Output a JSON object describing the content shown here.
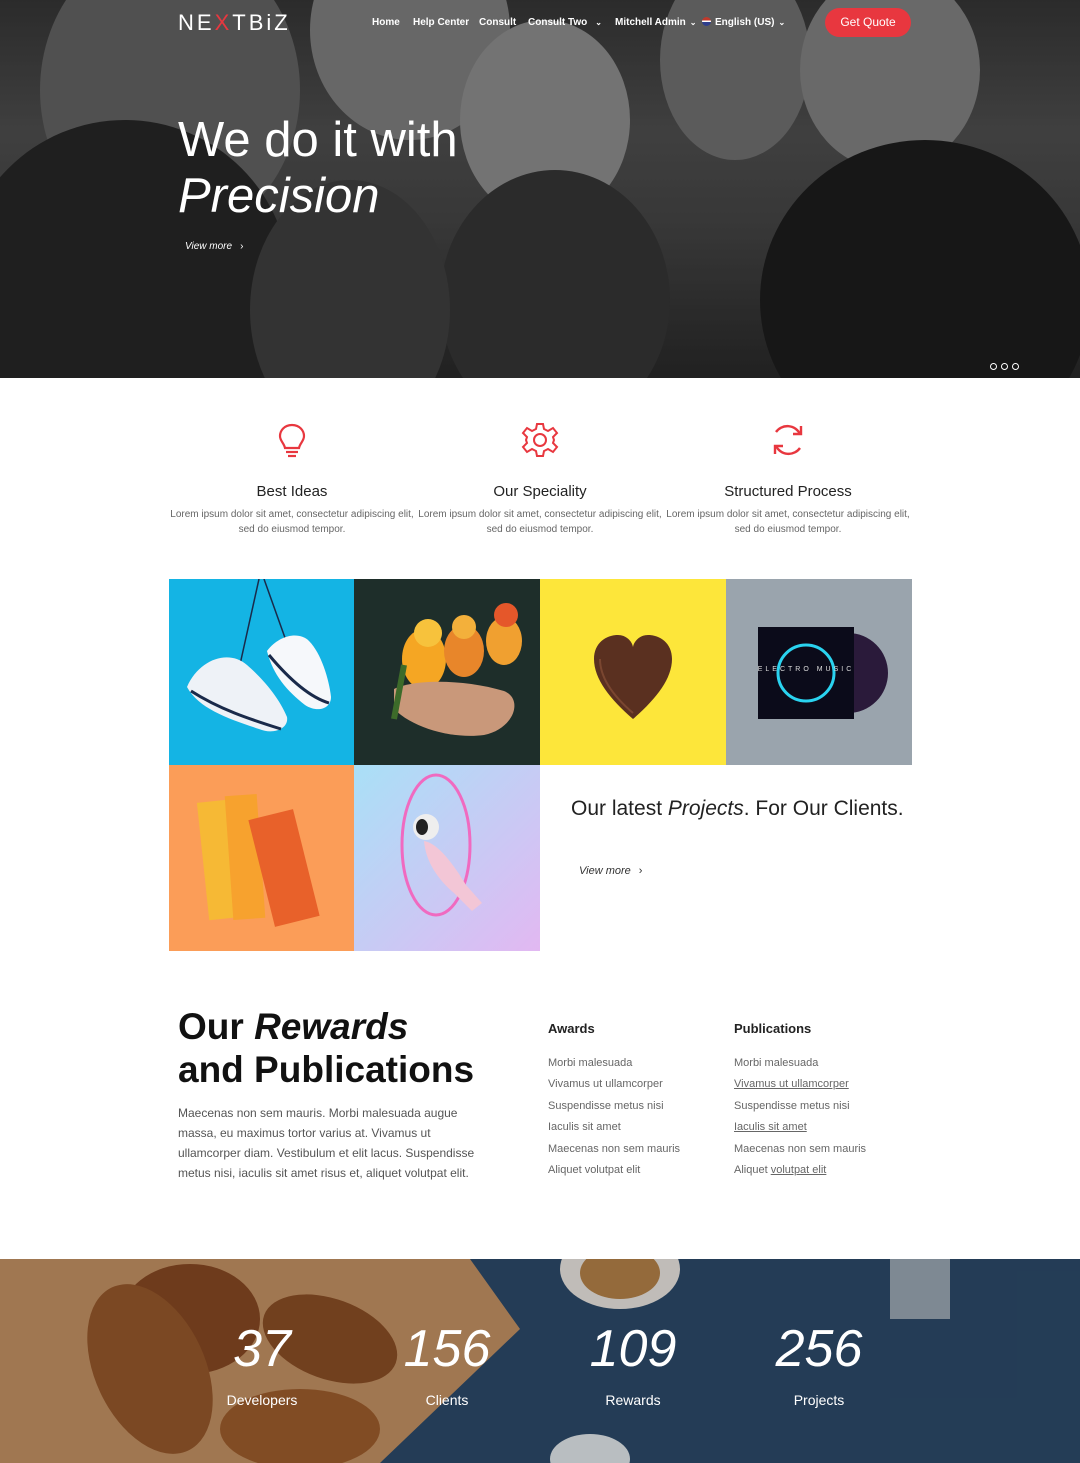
{
  "nav": {
    "logo": {
      "pre": "NE",
      "x": "X",
      "post": "TBiZ"
    },
    "items": [
      "Home",
      "Help Center",
      "Consult",
      "Consult Two",
      "Mitchell Admin",
      "English (US)"
    ],
    "cta": "Get Quote"
  },
  "hero": {
    "title_line1": "We do it with",
    "title_line2": "Precision",
    "link": "View more",
    "slides": 3,
    "active_slide": 1
  },
  "features": [
    {
      "icon": "lightbulb-icon",
      "title": "Best Ideas",
      "text": "Lorem ipsum dolor sit amet, consectetur adipiscing elit, sed do eiusmod tempor."
    },
    {
      "icon": "gear-icon",
      "title": "Our Speciality",
      "text": "Lorem ipsum dolor sit amet, consectetur adipiscing elit, sed do eiusmod tempor."
    },
    {
      "icon": "refresh-icon",
      "title": "Structured Process",
      "text": "Lorem ipsum dolor sit amet, consectetur adipiscing elit, sed do eiusmod tempor."
    }
  ],
  "gallery": {
    "cd_text": "ELECTRO MUSIC",
    "projects_pre": "Our latest ",
    "projects_em": "Projects",
    "projects_post": ". For Our Clients.",
    "link": "View more"
  },
  "rewards": {
    "title_pre": "Our ",
    "title_em": "Rewards",
    "title_post": "and Publications",
    "description": "Maecenas non sem mauris. Morbi malesuada augue massa, eu maximus tortor varius at. Vivamus ut ullamcorper diam. Vestibulum et elit lacus. Suspendisse metus nisi, iaculis sit amet risus et, aliquet volutpat elit.",
    "awards_heading": "Awards",
    "awards": [
      "Morbi malesuada",
      "Vivamus ut ullamcorper",
      "Suspendisse metus nisi",
      "Iaculis sit amet",
      "Maecenas non sem mauris",
      "Aliquet volutpat elit"
    ],
    "publications_heading": "Publications",
    "publications": [
      "Morbi malesuada",
      "Vivamus ut ullamcorper",
      "Suspendisse metus nisi",
      "Iaculis sit amet",
      "Maecenas non sem mauris",
      "Aliquet ",
      "volutpat elit"
    ]
  },
  "stats": [
    {
      "value": "37",
      "label": "Developers"
    },
    {
      "value": "156",
      "label": "Clients"
    },
    {
      "value": "109",
      "label": "Rewards"
    },
    {
      "value": "256",
      "label": "Projects"
    }
  ],
  "colors": {
    "accent": "#e8373f",
    "hero_overlay": "#3a3a3a",
    "stats_bg": "#2b4a6a"
  }
}
